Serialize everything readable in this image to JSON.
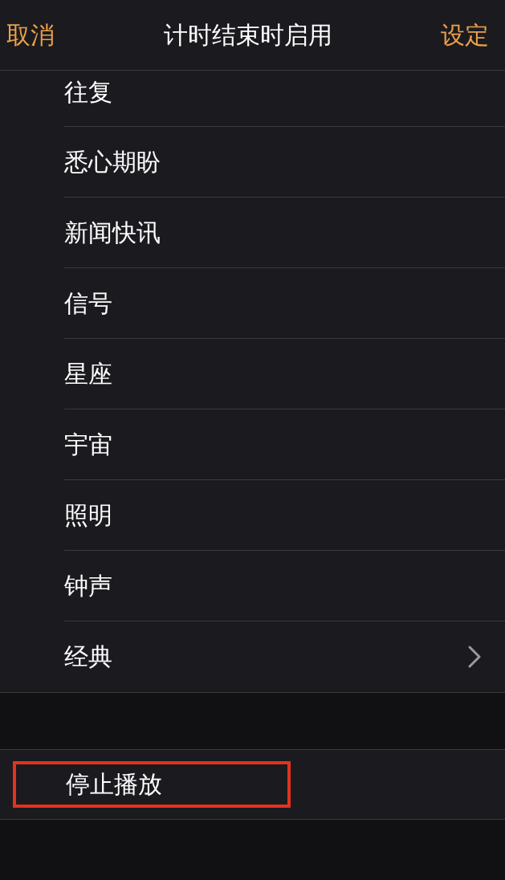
{
  "nav": {
    "cancel": "取消",
    "title": "计时结束时启用",
    "confirm": "设定"
  },
  "sounds": [
    {
      "label": "往复",
      "kind": "plain"
    },
    {
      "label": "悉心期盼",
      "kind": "plain"
    },
    {
      "label": "新闻快讯",
      "kind": "plain"
    },
    {
      "label": "信号",
      "kind": "plain"
    },
    {
      "label": "星座",
      "kind": "plain"
    },
    {
      "label": "宇宙",
      "kind": "plain"
    },
    {
      "label": "照明",
      "kind": "plain"
    },
    {
      "label": "钟声",
      "kind": "plain"
    },
    {
      "label": "经典",
      "kind": "submenu"
    }
  ],
  "stop": {
    "label": "停止播放",
    "highlighted": true
  }
}
